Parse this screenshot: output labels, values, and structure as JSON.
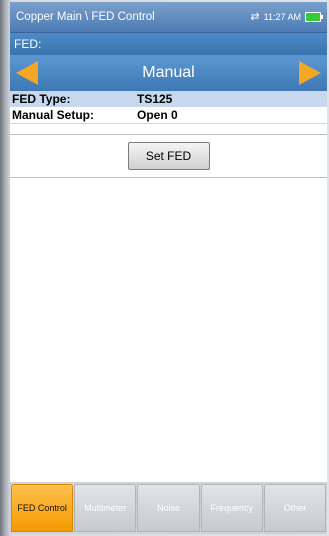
{
  "titlebar": {
    "title": "Copper Main \\ FED Control",
    "time": "11:27 AM"
  },
  "fed": {
    "header": "FED:",
    "mode": "Manual",
    "rows": [
      {
        "label": "FED Type:",
        "value": "TS125"
      },
      {
        "label": "Manual Setup:",
        "value": "Open 0"
      }
    ],
    "set_button": "Set FED"
  },
  "tabs": [
    {
      "label": "FED Control",
      "active": true
    },
    {
      "label": "Multimeter",
      "active": false
    },
    {
      "label": "Noise",
      "active": false
    },
    {
      "label": "Frequency",
      "active": false
    },
    {
      "label": "Other",
      "active": false
    }
  ],
  "colors": {
    "accent": "#f5a623",
    "titlebar": "#4d7bb4",
    "selected_row": "#c6d7ee"
  }
}
